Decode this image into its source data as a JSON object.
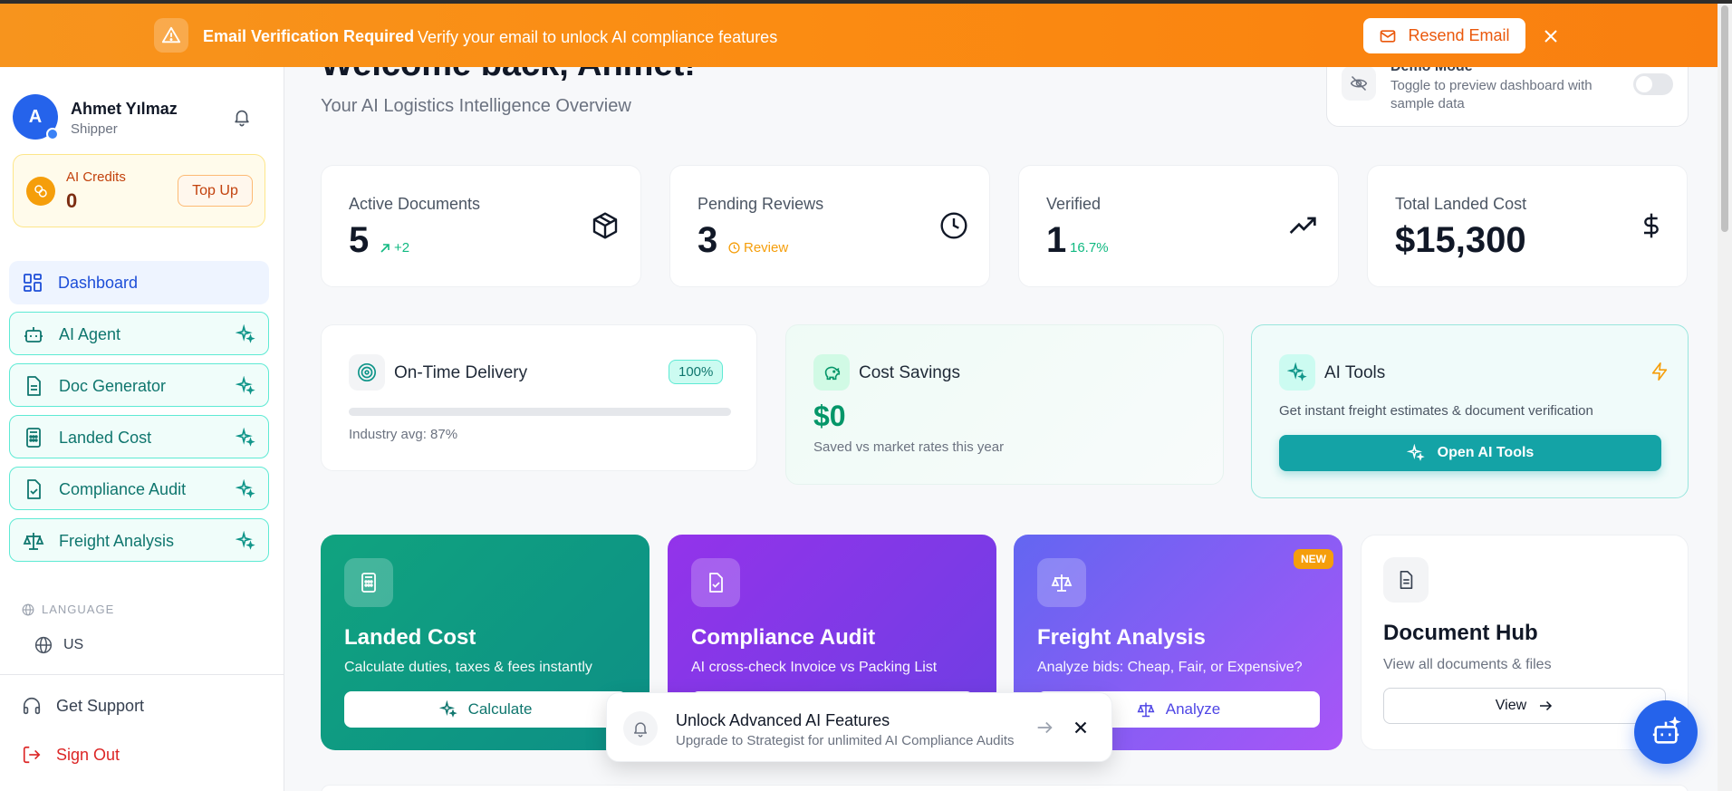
{
  "banner": {
    "title": "Email Verification Required",
    "message": "Verify your email to unlock AI compliance features",
    "resend_label": "Resend Email"
  },
  "user": {
    "initial": "A",
    "name": "Ahmet Yılmaz",
    "role": "Shipper"
  },
  "credits": {
    "label": "AI Credits",
    "value": "0",
    "topup_label": "Top Up"
  },
  "nav": {
    "dashboard": "Dashboard",
    "ai_agent": "AI Agent",
    "doc_generator": "Doc Generator",
    "landed_cost": "Landed Cost",
    "compliance_audit": "Compliance Audit",
    "freight_analysis": "Freight Analysis"
  },
  "language": {
    "heading": "LANGUAGE",
    "value": "US"
  },
  "footer_links": {
    "support": "Get Support",
    "signout": "Sign Out"
  },
  "header": {
    "welcome": "Welcome back, Ahmet!",
    "subtitle": "Your AI Logistics Intelligence Overview"
  },
  "demo": {
    "title": "Demo Mode",
    "description": "Toggle to preview dashboard with sample data",
    "enabled": false
  },
  "stats": {
    "active": {
      "label": "Active Documents",
      "value": "5",
      "sub": "+2"
    },
    "pending": {
      "label": "Pending Reviews",
      "value": "3",
      "sub": "Review"
    },
    "verified": {
      "label": "Verified",
      "value": "1",
      "sub": "16.7%"
    },
    "landed": {
      "label": "Total Landed Cost",
      "value": "$15,300"
    }
  },
  "delivery": {
    "title": "On-Time Delivery",
    "badge": "100%",
    "progress": 0,
    "note": "Industry avg: 87%"
  },
  "savings": {
    "title": "Cost Savings",
    "value": "$0",
    "note": "Saved vs market rates this year"
  },
  "ai_tools": {
    "title": "AI Tools",
    "description": "Get instant freight estimates & document verification",
    "button": "Open AI Tools"
  },
  "features": {
    "landed": {
      "title": "Landed Cost",
      "desc": "Calculate duties, taxes & fees instantly",
      "button": "Calculate"
    },
    "compliance": {
      "title": "Compliance Audit",
      "desc": "AI cross-check Invoice vs Packing List"
    },
    "freight": {
      "title": "Freight Analysis",
      "desc": "Analyze bids: Cheap, Fair, or Expensive?",
      "button": "Analyze",
      "badge": "NEW"
    },
    "hub": {
      "title": "Document Hub",
      "desc": "View all documents & files",
      "button": "View"
    }
  },
  "toast": {
    "title": "Unlock Advanced AI Features",
    "desc": "Upgrade to Strategist for unlimited AI Compliance Audits"
  },
  "colors": {
    "banner": "#f7941d",
    "primary": "#2563eb",
    "teal": "#14a3a6",
    "amber": "#f59e0b"
  }
}
